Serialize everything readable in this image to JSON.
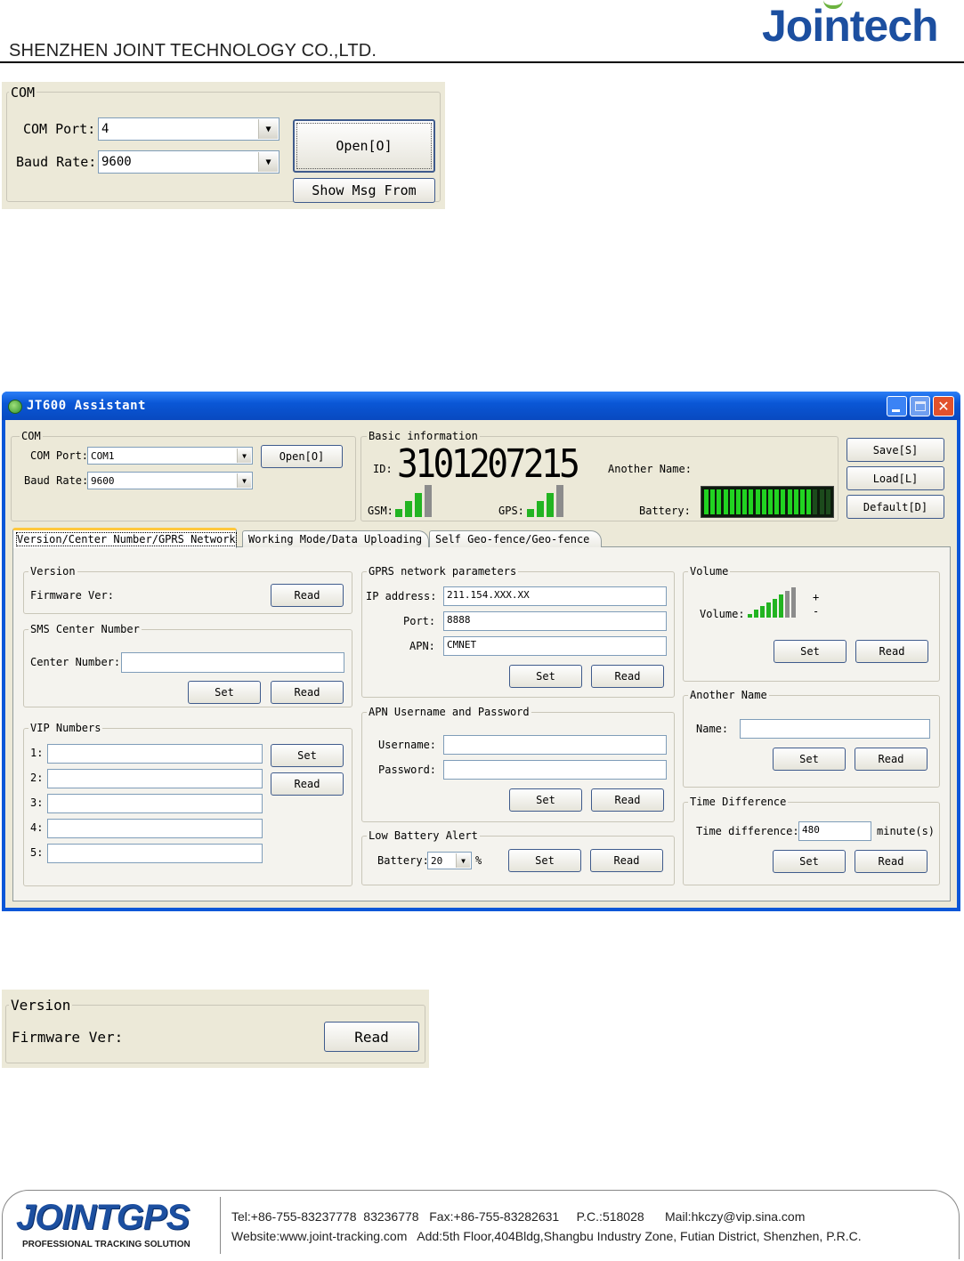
{
  "header": {
    "company": "SHENZHEN JOINT TECHNOLOGY CO.,LTD.",
    "logo": "Jointech"
  },
  "com_small": {
    "title": "COM",
    "com_port_label": "COM Port:",
    "com_port_value": "4",
    "baud_label": "Baud Rate:",
    "baud_value": "9600",
    "open_btn": "Open[O]",
    "show_msg_btn": "Show Msg From"
  },
  "app": {
    "title": "JT600 Assistant",
    "com": {
      "title": "COM",
      "com_port_label": "COM Port:",
      "com_port_value": "COM1",
      "baud_label": "Baud Rate:",
      "baud_value": "9600",
      "open_btn": "Open[O]"
    },
    "basic": {
      "title": "Basic information",
      "id_label": "ID:",
      "id_value": "3101207215",
      "another_name_label": "Another Name:",
      "gsm_label": "GSM:",
      "gps_label": "GPS:",
      "battery_label": "Battery:",
      "gsm_level": 0.75,
      "gps_level": 0.75,
      "battery_level": 0.85
    },
    "side_buttons": {
      "save": "Save[S]",
      "load": "Load[L]",
      "default": "Default[D]"
    },
    "tabs": [
      "Version/Center Number/GPRS Network",
      "Working Mode/Data Uploading",
      "Self Geo-fence/Geo-fence"
    ],
    "version": {
      "title": "Version",
      "firmware_label": "Firmware Ver:",
      "read_btn": "Read"
    },
    "sms": {
      "title": "SMS Center Number",
      "center_label": "Center Number:",
      "center_value": "",
      "set_btn": "Set",
      "read_btn": "Read"
    },
    "vip": {
      "title": "VIP Numbers",
      "labels": [
        "1:",
        "2:",
        "3:",
        "4:",
        "5:"
      ],
      "set_btn": "Set",
      "read_btn": "Read"
    },
    "gprs": {
      "title": "GPRS network parameters",
      "ip_label": "IP address:",
      "ip_value": "211.154.XXX.XX",
      "port_label": "Port:",
      "port_value": "8888",
      "apn_label": "APN:",
      "apn_value": "CMNET",
      "set_btn": "Set",
      "read_btn": "Read"
    },
    "apn_user": {
      "title": "APN Username and Password",
      "user_label": "Username:",
      "pass_label": "Password:",
      "set_btn": "Set",
      "read_btn": "Read"
    },
    "low_battery": {
      "title": "Low Battery Alert",
      "battery_label": "Battery:",
      "battery_value": "20",
      "unit": "%",
      "set_btn": "Set",
      "read_btn": "Read"
    },
    "volume": {
      "title": "Volume",
      "volume_label": "Volume:",
      "plus": "+",
      "minus": "-",
      "level": 0.8,
      "set_btn": "Set",
      "read_btn": "Read"
    },
    "another_name": {
      "title": "Another Name",
      "name_label": "Name:",
      "set_btn": "Set",
      "read_btn": "Read"
    },
    "time_diff": {
      "title": "Time Difference",
      "label": "Time difference:",
      "value": "480",
      "unit": "minute(s)",
      "set_btn": "Set",
      "read_btn": "Read"
    }
  },
  "version_small": {
    "title": "Version",
    "firmware_label": "Firmware Ver:",
    "read_btn": "Read"
  },
  "footer": {
    "logo_main": "JOINTGPS",
    "logo_sub": "PROFESSIONAL TRACKING SOLUTION",
    "line1": "Tel:+86-755-83237778  83236778   Fax:+86-755-83282631     P.C.:518028      Mail:hkczy@vip.sina.com",
    "line2": "Website:www.joint-tracking.com   Add:5th Floor,404Bldg,Shangbu Industry Zone, Futian District, Shenzhen, P.R.C."
  },
  "colors": {
    "accent": "#1c4fa0",
    "xp_title": "#0a5fe0",
    "signal": "#22b421"
  }
}
